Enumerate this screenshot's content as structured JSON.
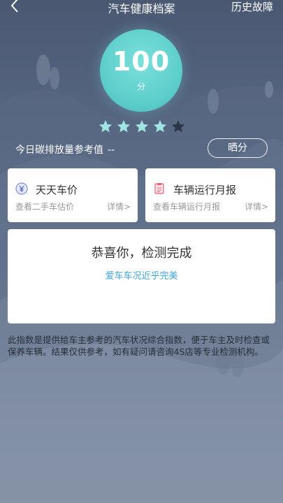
{
  "header": {
    "title": "汽车健康档案",
    "history_label": "历史故障"
  },
  "score": {
    "value": "100",
    "unit": "分",
    "rating": 4,
    "rating_max": 5
  },
  "carbon": {
    "label": "今日碳排放量参考值",
    "value": "--"
  },
  "share_label": "晒分",
  "cards": {
    "car_price": {
      "title": "天天车价",
      "subtitle": "查看二手车估价",
      "more": "详情>",
      "icon": "yuan-icon"
    },
    "monthly_report": {
      "title": "车辆运行月报",
      "subtitle": "查看车辆运行月报",
      "more": "详情>",
      "icon": "report-icon"
    }
  },
  "result": {
    "title": "恭喜你，检测完成",
    "subtitle": "爱车车况近乎完美"
  },
  "disclaimer": "此指数是提供给车主参考的汽车状况综合指数，便于车主及时检查或保养车辆。结果仅供参考，如有疑问请咨询4S店等专业检测机构。",
  "colors": {
    "accent_teal": "#5fcfcc",
    "link_blue": "#3fa6d6",
    "star_filled": "#9fe6e2",
    "star_empty": "#2c3646"
  }
}
